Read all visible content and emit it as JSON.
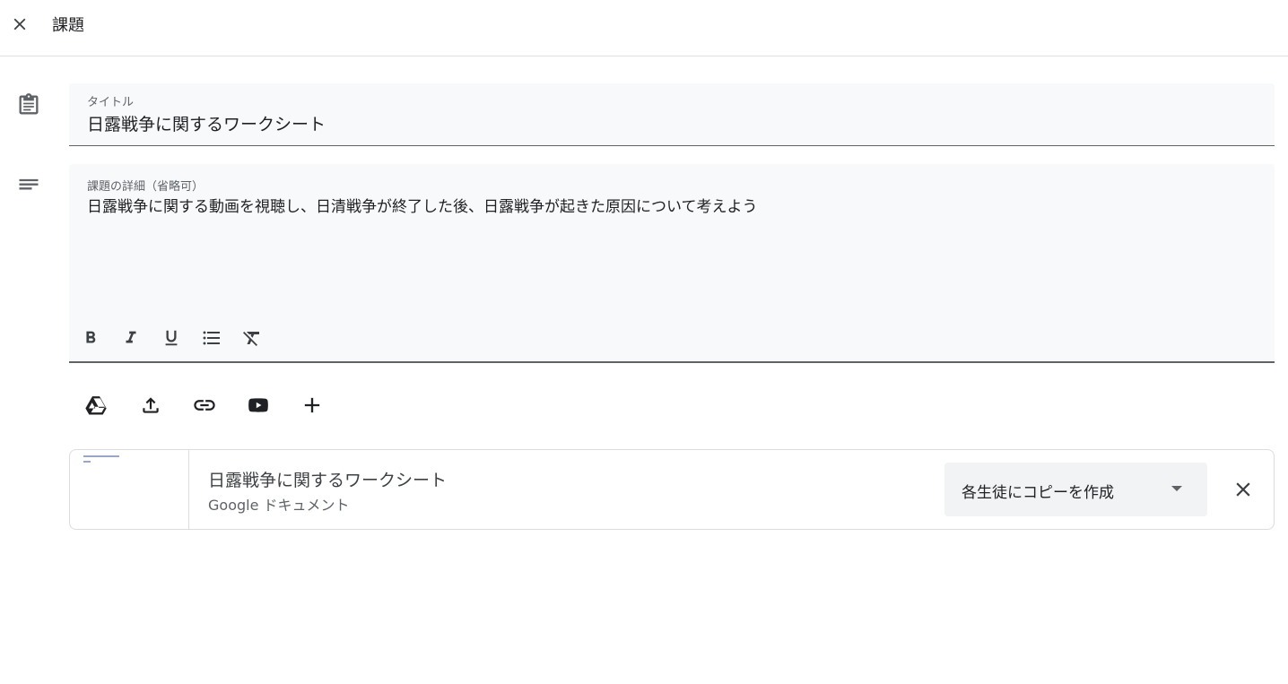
{
  "header": {
    "title": "課題",
    "close_icon": "close-icon"
  },
  "form": {
    "title_label": "タイトル",
    "title_value": "日露戦争に関するワークシート",
    "details_label": "課題の詳細（省略可）",
    "details_value": "日露戦争に関する動画を視聴し、日清戦争が終了した後、日露戦争が起きた原因について考えよう"
  },
  "format_toolbar": {
    "buttons": [
      "bold-icon",
      "italic-icon",
      "underline-icon",
      "bulleted-list-icon",
      "clear-formatting-icon"
    ]
  },
  "attach_toolbar": {
    "buttons": [
      "google-drive-icon",
      "upload-icon",
      "link-icon",
      "youtube-icon",
      "add-icon"
    ]
  },
  "attachment": {
    "name": "日露戦争に関するワークシート",
    "type": "Google ドキュメント",
    "share_option": "各生徒にコピーを作成"
  },
  "colors": {
    "field_bg": "#f8f9fa",
    "text": "#202124",
    "secondary_text": "#5f6368",
    "border": "#dadce0"
  }
}
